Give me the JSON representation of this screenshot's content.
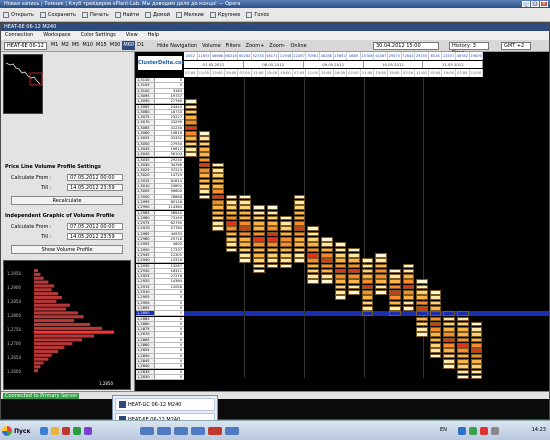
{
  "window_title": "Новая запись | Темник | Клуб трейдеров xPlant-Lab. Мы доводим дело до конца! — Opera",
  "browser_toolbar": [
    {
      "label": "Открыть",
      "icon": "folder-icon"
    },
    {
      "label": "Сохранить",
      "icon": "save-icon"
    },
    {
      "label": "Печать",
      "icon": "print-icon"
    },
    {
      "label": "Найти",
      "icon": "search-icon"
    },
    {
      "label": "Домой",
      "icon": "home-icon"
    },
    {
      "label": "Мелкие",
      "icon": "zoom-out-icon"
    },
    {
      "label": "Крупнее",
      "icon": "zoom-in-icon"
    },
    {
      "label": "Голос",
      "icon": "voice-icon"
    }
  ],
  "app": {
    "title": "HEAT-6E 06-12 M240",
    "menu": [
      "Connection",
      "Workspace",
      "Color Settings",
      "View",
      "Help"
    ],
    "symbol": "HEAT-6E 06-12",
    "timeframes": [
      "M1",
      "M2",
      "M5",
      "M10",
      "M15",
      "M30",
      "M60",
      "D1"
    ],
    "active_timeframe": "M60",
    "toolbar_items": [
      "Hide Navigation",
      "Volume",
      "Filters",
      "Zoom+",
      "Zoom-",
      "Online"
    ],
    "date_field": "30.04.2012 15:00",
    "history": "History: 3 Days",
    "timezone": "GMT +2"
  },
  "left_panel": {
    "price_line_title": "Price Line Volume Profile Settings",
    "calc_from_label": "Calculate From :",
    "calc_from_value": "07.05.2012 00:00",
    "till_label": "Till :",
    "till_value": "14.05.2012 23:59",
    "recalc_button": "Recalculate",
    "independent_title": "Independent Graphic of Volume Profile",
    "ind_from_value": "07.05.2012 00:00",
    "ind_till_value": "14.05.2012 23:59",
    "show_button": "Show Volume Profile",
    "profile_prices": [
      "1,2950",
      "1,2900",
      "1,2850",
      "1,2800",
      "1,2750",
      "1,2700",
      "1,2650",
      "1,2600"
    ],
    "profile_bars": [
      0.05,
      0.08,
      0.12,
      0.18,
      0.25,
      0.22,
      0.3,
      0.35,
      0.28,
      0.45,
      0.4,
      0.55,
      0.62,
      0.5,
      0.7,
      0.85,
      1.0,
      0.75,
      0.6,
      0.48,
      0.38,
      0.3,
      0.22,
      0.18,
      0.12,
      0.08,
      0.05
    ],
    "profile_footer": "1,2850"
  },
  "grid": {
    "logo": "ClusterDelta.com",
    "header_totals": [
      "2432",
      "11655",
      "46668",
      "66216",
      "60282",
      "52735",
      "46171",
      "11948",
      "22267",
      "70981",
      "48286",
      "25692",
      "4669",
      "15788",
      "41067",
      "29075",
      "72644",
      "29155",
      "6516",
      "22557",
      "46782",
      "19876"
    ],
    "dates": [
      "07.05.2012",
      "08.05.2012",
      "09.05.2012",
      "10.05.2012",
      "11.05.2012"
    ],
    "prices": [
      "1,3110",
      "1,3105",
      "1,3100",
      "1,3095",
      "1,3090",
      "1,3085",
      "1,3080",
      "1,3075",
      "1,3070",
      "1,3065",
      "1,3060",
      "1,3055",
      "1,3050",
      "1,3045",
      "1,3040",
      "1,3035",
      "1,3030",
      "1,3025",
      "1,3020",
      "1,3015",
      "1,3010",
      "1,3005",
      "1,3000",
      "1,2995",
      "1,2990",
      "1,2985",
      "1,2980",
      "1,2975",
      "1,2970",
      "1,2965",
      "1,2960",
      "1,2955",
      "1,2950",
      "1,2945",
      "1,2940",
      "1,2935",
      "1,2930",
      "1,2925",
      "1,2920",
      "1,2915",
      "1,2910",
      "1,2905",
      "1,2900",
      "1,2895",
      "1,2890",
      "1,2885",
      "1,2880",
      "1,2875",
      "1,2870",
      "1,2865",
      "1,2860",
      "1,2855",
      "1,2850",
      "1,2845",
      "1,2840",
      "1,2835",
      "1,2830"
    ],
    "volumes": [
      "0",
      "0",
      "3183",
      "19737",
      "27760",
      "24443",
      "18733",
      "23227",
      "33299",
      "41230",
      "14818",
      "33332",
      "27930",
      "18612",
      "56103",
      "29230",
      "34768",
      "37223",
      "14729",
      "61814",
      "53892",
      "56600",
      "78868",
      "80126",
      "114364",
      "56840",
      "73149",
      "62790",
      "57780",
      "44933",
      "25718",
      "4605",
      "17337",
      "12305",
      "14318",
      "13287",
      "16311",
      "27276",
      "14364",
      "12058",
      "0",
      "0",
      "0",
      "0",
      "0",
      "0",
      "0",
      "0",
      "0",
      "0",
      "0",
      "0",
      "0",
      "0",
      "0",
      "0",
      "0"
    ],
    "highlight_price": "1,2890",
    "highlight_volume": "114364"
  },
  "status": {
    "connection": "Connected to Primary Server"
  },
  "popup_items": [
    "HEAT-GC 06-12 M240",
    "HEAT-6E 06-12 M240"
  ],
  "taskbar": {
    "start_label": "Пуск",
    "lang": "EN",
    "clock": "14:23"
  },
  "colors": {
    "highlight_row": "#1a2fb0",
    "cluster_light": "#fff3c7",
    "cluster_mid": "#ffb347",
    "cluster_hot": "#ff6b1a",
    "cluster_max": "#e0341a"
  }
}
